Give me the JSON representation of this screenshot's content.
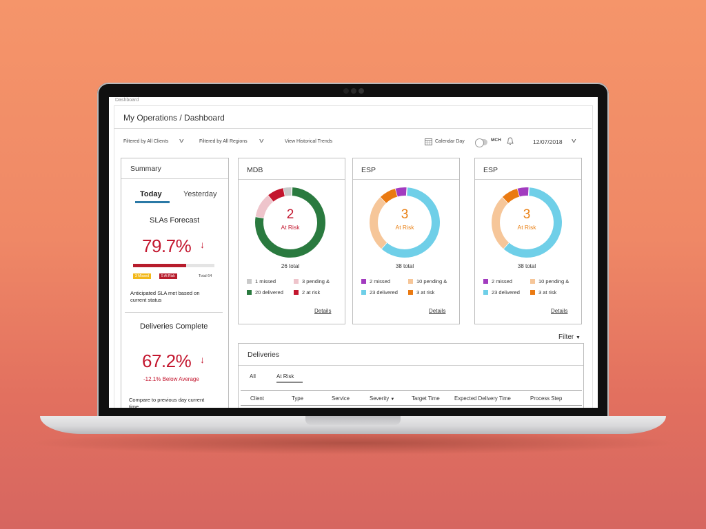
{
  "header": {
    "breadcrumb_top": "Dashboard",
    "title": "My Operations / Dashboard"
  },
  "filters": {
    "clients": "Filtered by All Clients",
    "regions": "Filtered by All Regions",
    "historical": "View Historical Trends",
    "calendar": "Calendar Day",
    "toggle_label": "MCH",
    "date": "12/07/2018"
  },
  "summary": {
    "title": "Summary",
    "tabs": {
      "today": "Today",
      "yesterday": "Yesterday"
    },
    "slas": {
      "title": "SLAs Forecast",
      "value": "79.7%",
      "bar_fill_fraction": 0.65,
      "badge_missed": "3 Missed",
      "badge_at_risk": "5 At Risk",
      "total": "Total 64",
      "note_line1": "Anticipated SLA met based on",
      "note_line2": "current status"
    },
    "deliveries": {
      "title": "Deliveries Complete",
      "value": "67.2%",
      "sub": "-12.1% Below Average",
      "note_line1": "Compare to previous day current",
      "note_line2": "time"
    }
  },
  "donuts": [
    {
      "name": "MDB",
      "count": "2",
      "status": "At Risk",
      "status_color": "#c3162e",
      "total": "26 total",
      "legend": [
        {
          "label": "1 missed",
          "color": "#c9c9c9"
        },
        {
          "label": "3 pending &",
          "color": "#eec4cb"
        },
        {
          "label": "20 delivered",
          "color": "#2a7a3f"
        },
        {
          "label": "2 at risk",
          "color": "#c3162e"
        }
      ],
      "details": "Details"
    },
    {
      "name": "ESP",
      "count": "3",
      "status": "At Risk",
      "status_color": "#e97f12",
      "total": "38 total",
      "legend": [
        {
          "label": "2 missed",
          "color": "#a23bbf"
        },
        {
          "label": "10 pending &",
          "color": "#f6c699"
        },
        {
          "label": "23 delivered",
          "color": "#6fcfe8"
        },
        {
          "label": "3 at risk",
          "color": "#ea7a12"
        }
      ],
      "details": "Details"
    },
    {
      "name": "ESP",
      "count": "3",
      "status": "At Risk",
      "status_color": "#e97f12",
      "total": "38 total",
      "legend": [
        {
          "label": "2 missed",
          "color": "#a23bbf"
        },
        {
          "label": "10 pending &",
          "color": "#f6c699"
        },
        {
          "label": "23 delivered",
          "color": "#6fcfe8"
        },
        {
          "label": "3 at risk",
          "color": "#ea7a12"
        }
      ],
      "details": "Details"
    }
  ],
  "deliveries_table": {
    "filter_label": "Filter",
    "title": "Deliveries",
    "tabs": {
      "all": "All",
      "at_risk": "At Risk"
    },
    "columns": {
      "client": "Client",
      "type": "Type",
      "service": "Service",
      "severity": "Severity",
      "target_time": "Target Time",
      "expected": "Expected Delivery Time",
      "process": "Process Step"
    }
  },
  "chart_data": [
    {
      "type": "pie",
      "title": "MDB",
      "categories": [
        "missed",
        "pending &",
        "delivered",
        "at risk"
      ],
      "values": [
        1,
        3,
        20,
        2
      ],
      "colors": [
        "#c9c9c9",
        "#eec4cb",
        "#2a7a3f",
        "#c3162e"
      ]
    },
    {
      "type": "pie",
      "title": "ESP",
      "categories": [
        "missed",
        "pending &",
        "delivered",
        "at risk"
      ],
      "values": [
        2,
        10,
        23,
        3
      ],
      "colors": [
        "#a23bbf",
        "#f6c699",
        "#6fcfe8",
        "#ea7a12"
      ]
    },
    {
      "type": "pie",
      "title": "ESP",
      "categories": [
        "missed",
        "pending &",
        "delivered",
        "at risk"
      ],
      "values": [
        2,
        10,
        23,
        3
      ],
      "colors": [
        "#a23bbf",
        "#f6c699",
        "#6fcfe8",
        "#ea7a12"
      ]
    }
  ]
}
